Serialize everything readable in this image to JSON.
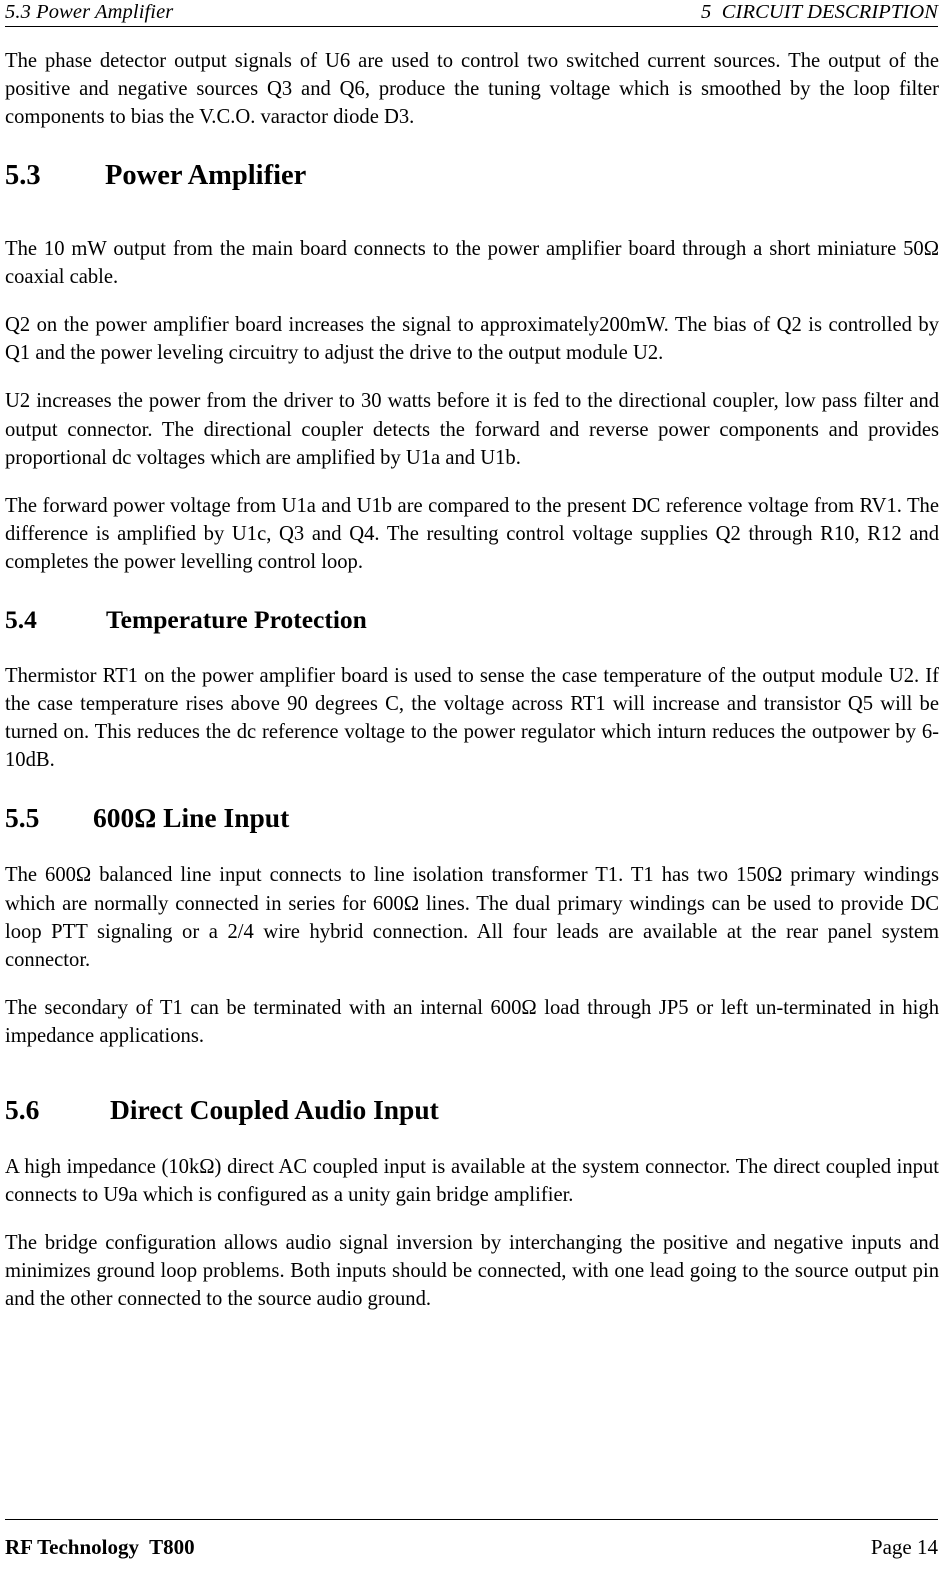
{
  "header": {
    "left": "5.3 Power Amplifier",
    "right": "5  CIRCUIT DESCRIPTION"
  },
  "content": {
    "intro_paragraph": "The phase detector output signals of U6 are used to control two switched current sources. The output of the positive and negative sources Q3 and Q6, produce the tuning voltage which is smoothed by the loop filter components to bias the V.C.O. varactor diode D3.",
    "sections": [
      {
        "number": "5.3",
        "title": "Power Amplifier",
        "paragraphs": [
          "The 10 mW output from the main board connects to the power amplifier board through a short miniature 50Ω coaxial cable.",
          "Q2 on the power amplifier board increases the signal to approximately200mW. The bias of Q2 is controlled by Q1 and the power leveling circuitry to adjust the drive to the output module U2.",
          "U2 increases the power from the driver to 30 watts before it is fed to the directional coupler, low pass filter and output connector.   The directional coupler detects the forward and reverse power components and provides proportional dc voltages which are amplified by U1a and U1b.",
          "The forward power voltage from U1a and U1b are compared to the present DC reference voltage from RV1.   The difference is amplified by U1c, Q3 and Q4.   The resulting control voltage supplies Q2 through R10, R12 and completes the power levelling control loop."
        ]
      },
      {
        "number": "5.4",
        "title": "Temperature Protection",
        "paragraphs": [
          "Thermistor RT1 on the power amplifier board is used to sense the case temperature of the output module U2.   If the case temperature rises above 90 degrees C, the voltage across RT1 will increase and transistor Q5 will be turned on.   This reduces the dc reference voltage to the power regulator which inturn reduces the outpower by 6-10dB."
        ]
      },
      {
        "number": "5.5",
        "title": "600Ω Line Input",
        "paragraphs": [
          "The 600Ω balanced line input connects to line isolation transformer T1.  T1 has two 150Ω primary windings which are normally connected in series for 600Ω lines.  The dual primary windings can be used to provide DC loop PTT signaling or a 2/4 wire hybrid connection.  All four leads are available at the rear panel system connector.",
          "The secondary of T1 can be terminated with an internal 600Ω load through JP5 or left un-terminated in high impedance applications."
        ]
      },
      {
        "number": "5.6",
        "title": "Direct Coupled Audio Input",
        "paragraphs": [
          "A high impedance (10kΩ) direct AC coupled input is available at the system connector.  The direct coupled input connects to U9a which is configured as a unity gain bridge amplifier.",
          "The bridge configuration allows audio signal inversion by interchanging the positive and negative inputs and minimizes ground loop problems.  Both inputs should be connected, with one lead going to the source output pin and the other connected to the source audio ground."
        ]
      }
    ]
  },
  "footer": {
    "left": "RF Technology  T800",
    "right": "Page 14"
  }
}
